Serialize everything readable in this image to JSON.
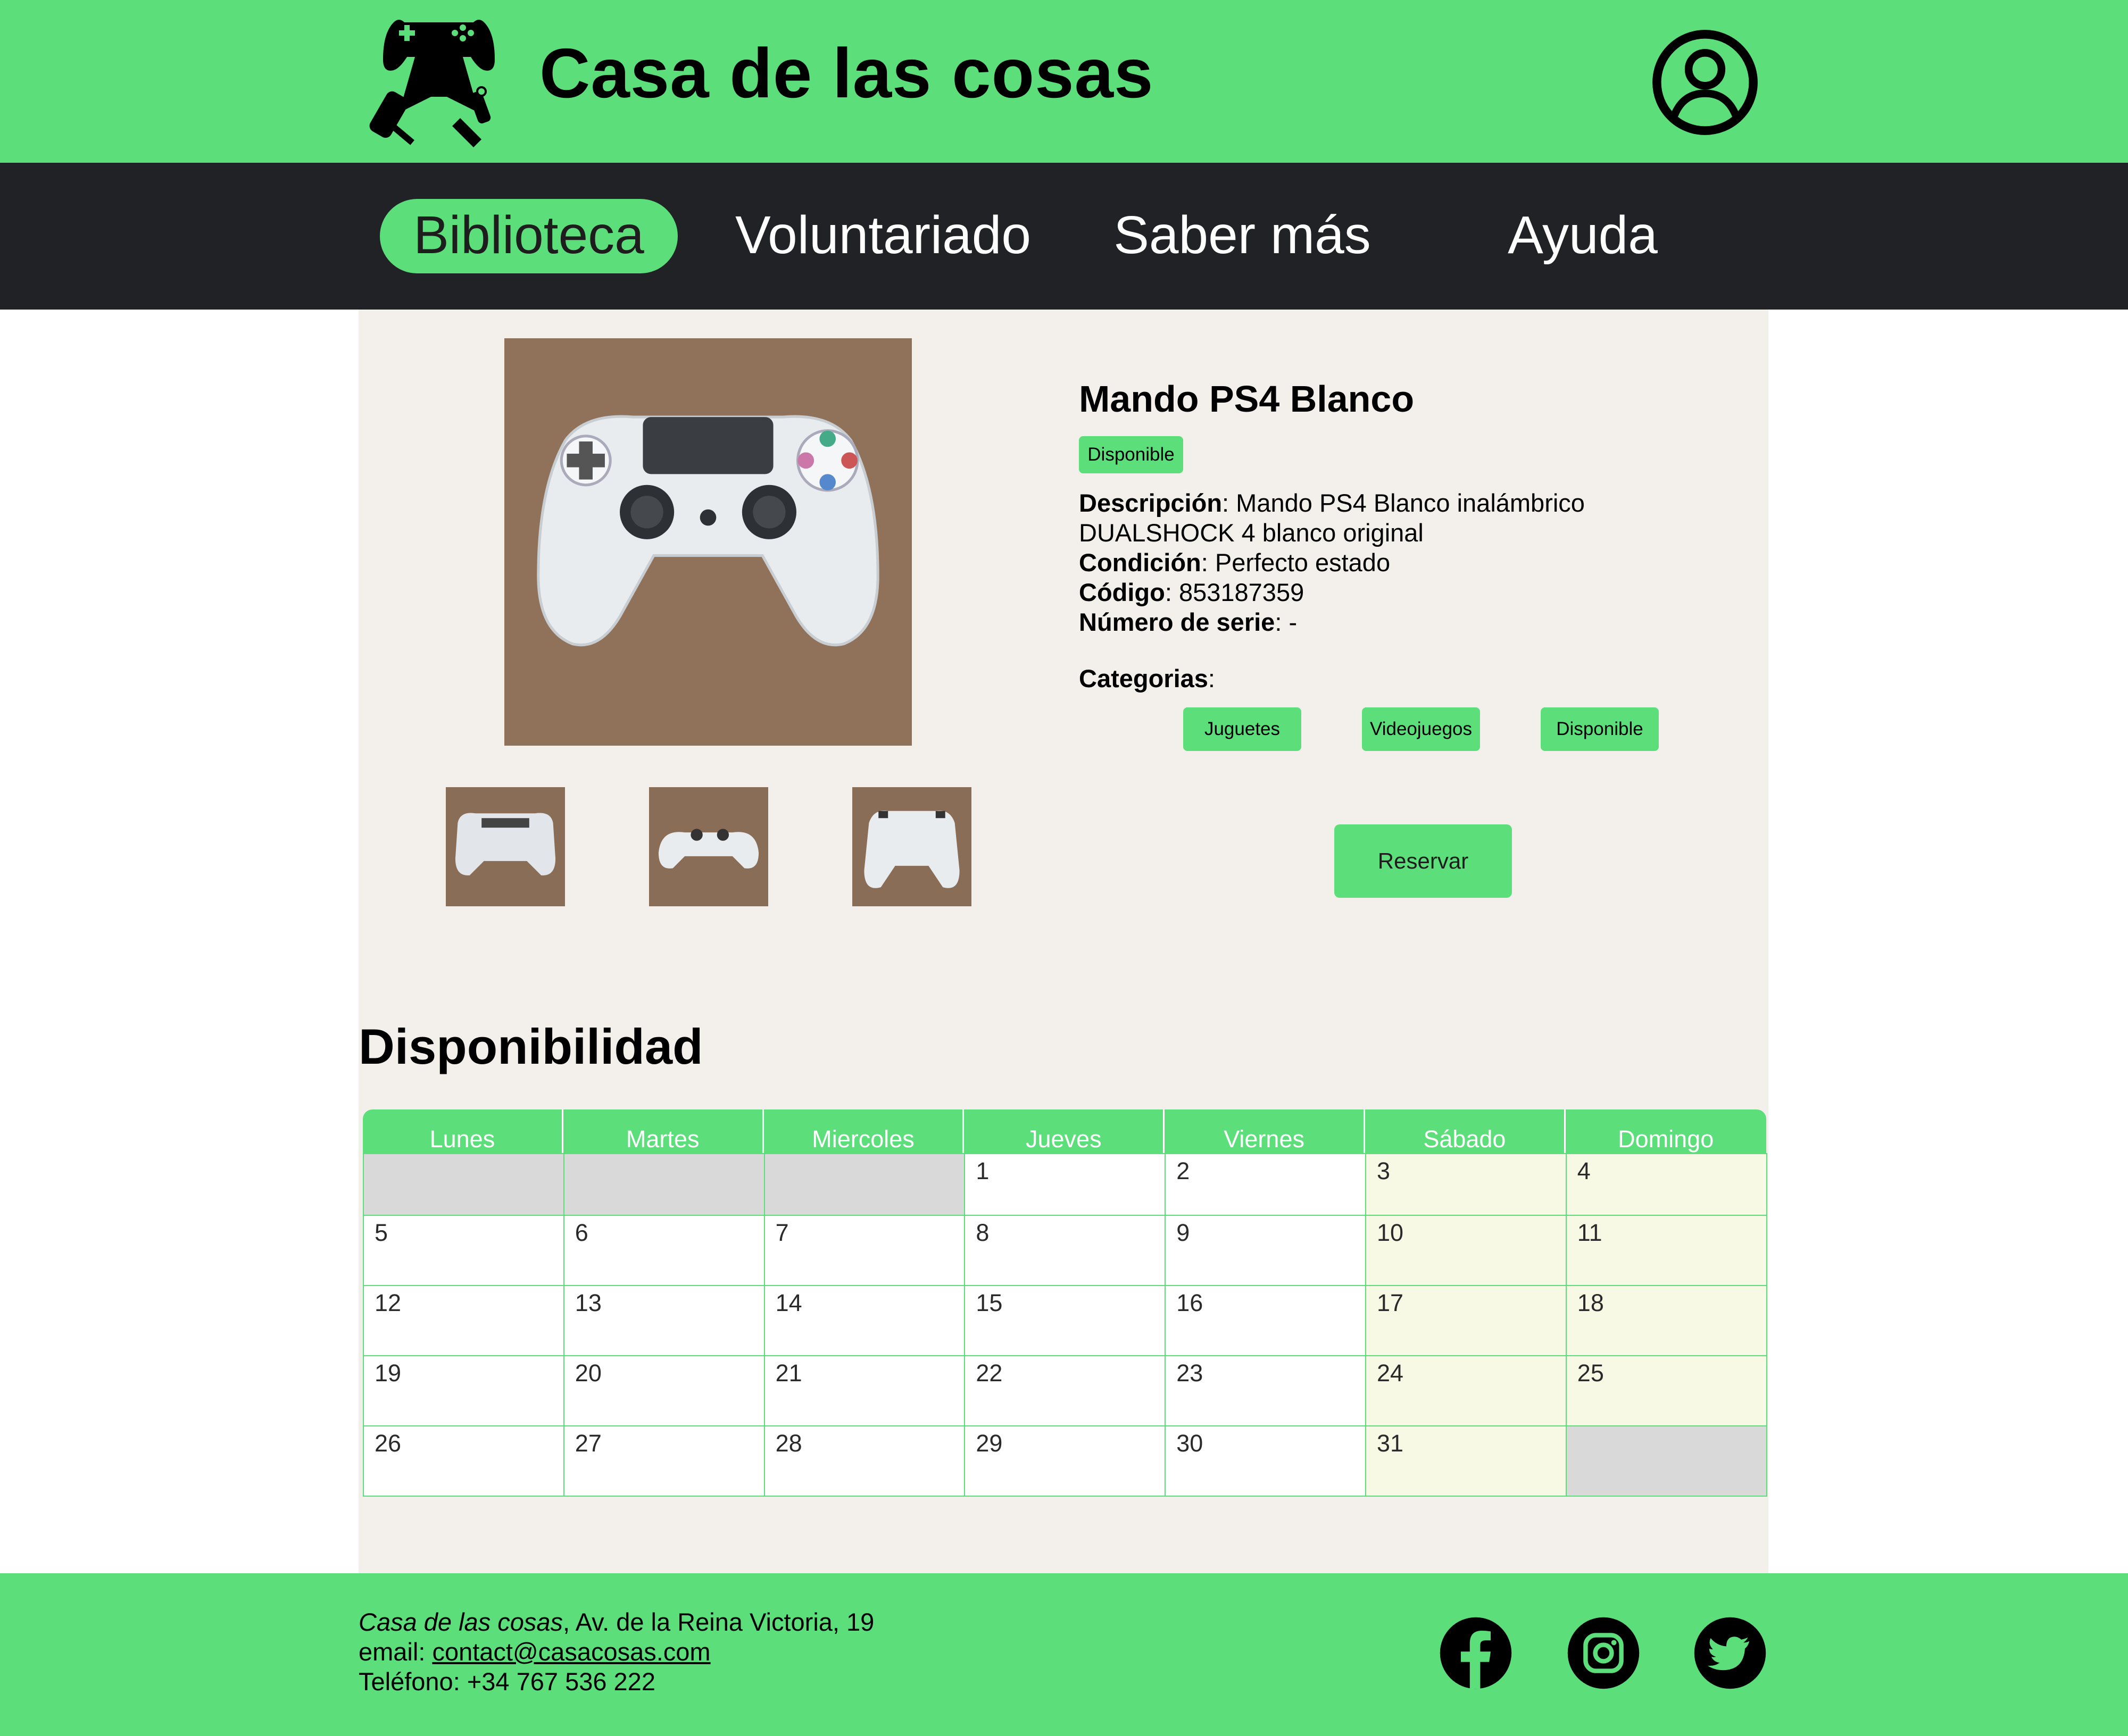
{
  "header": {
    "site_title": "Casa de las cosas"
  },
  "nav": {
    "items": [
      {
        "label": "Biblioteca",
        "active": true
      },
      {
        "label": "Voluntariado",
        "active": false
      },
      {
        "label": "Saber más",
        "active": false
      },
      {
        "label": "Ayuda",
        "active": false
      }
    ]
  },
  "product": {
    "title": "Mando PS4 Blanco",
    "status": "Disponible",
    "description_label": "Descripción",
    "description_line1": "Mando PS4 Blanco inalámbrico",
    "description_line2": "DUALSHOCK 4 blanco original",
    "condition_label": "Condición",
    "condition": "Perfecto estado",
    "code_label": "Código",
    "code": "853187359",
    "serial_label": "Número de serie",
    "serial": "-",
    "categories_label": "Categorias",
    "categories": [
      "Juguetes",
      "Videojuegos",
      "Disponible"
    ],
    "reserve_label": "Reservar"
  },
  "availability": {
    "title": "Disponibilidad",
    "days": [
      "Lunes",
      "Martes",
      "Miercoles",
      "Jueves",
      "Viernes",
      "Sábado",
      "Domingo"
    ],
    "weeks": [
      [
        "",
        "",
        "",
        "1",
        "2",
        "3",
        "4"
      ],
      [
        "5",
        "6",
        "7",
        "8",
        "9",
        "10",
        "11"
      ],
      [
        "12",
        "13",
        "14",
        "15",
        "16",
        "17",
        "18"
      ],
      [
        "19",
        "20",
        "21",
        "22",
        "23",
        "24",
        "25"
      ],
      [
        "26",
        "27",
        "28",
        "29",
        "30",
        "31",
        ""
      ]
    ]
  },
  "footer": {
    "name": "Casa de las cosas",
    "address": ", Av. de la Reina Victoria, 19",
    "email_label": "email: ",
    "email": "contact@casacosas.com",
    "phone_label": "Teléfono: ",
    "phone": "+34 767 536 222"
  },
  "colors": {
    "brand_green": "#5cde7a",
    "nav_dark": "#212226",
    "panel_bg": "#f3f0eb",
    "weekend_bg": "#f7f9e4",
    "unavailable_bg": "#d9d9d9"
  },
  "icons": [
    "gamepad-tools-logo-icon",
    "user-account-icon",
    "facebook-icon",
    "instagram-icon",
    "twitter-icon"
  ]
}
